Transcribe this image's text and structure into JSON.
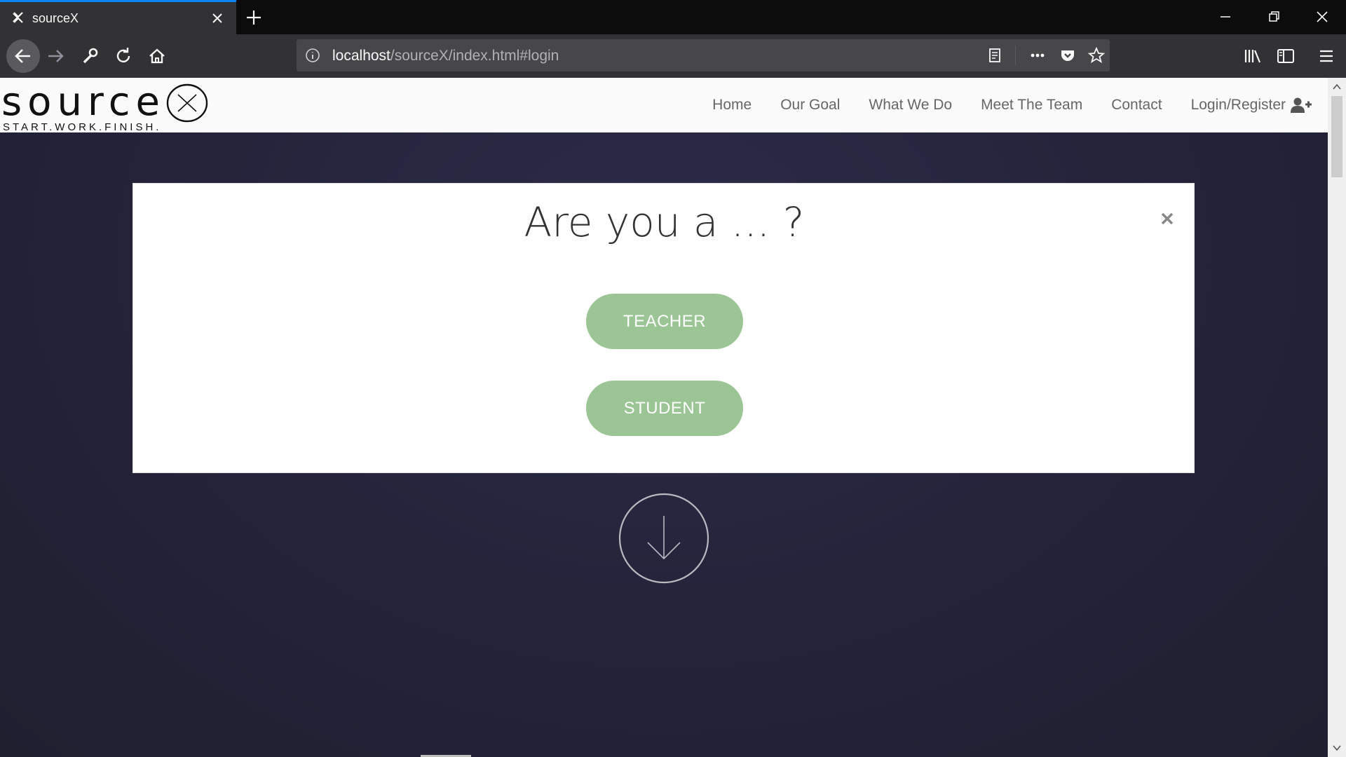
{
  "browser": {
    "tab_title": "sourceX",
    "url_host": "localhost",
    "url_path": "/sourceX/index.html#login"
  },
  "site": {
    "logo_text": "source",
    "logo_tagline": "START.WORK.FINISH.",
    "menu": [
      "Home",
      "Our Goal",
      "What We Do",
      "Meet The Team",
      "Contact",
      "Login/Register"
    ]
  },
  "modal": {
    "title": "Are you a ... ?",
    "close_label": "×",
    "teacher_label": "TEACHER",
    "student_label": "STUDENT"
  },
  "colors": {
    "accent_tab": "#0a84ff",
    "role_button": "#9bc594",
    "hero_bg": "#252439"
  }
}
